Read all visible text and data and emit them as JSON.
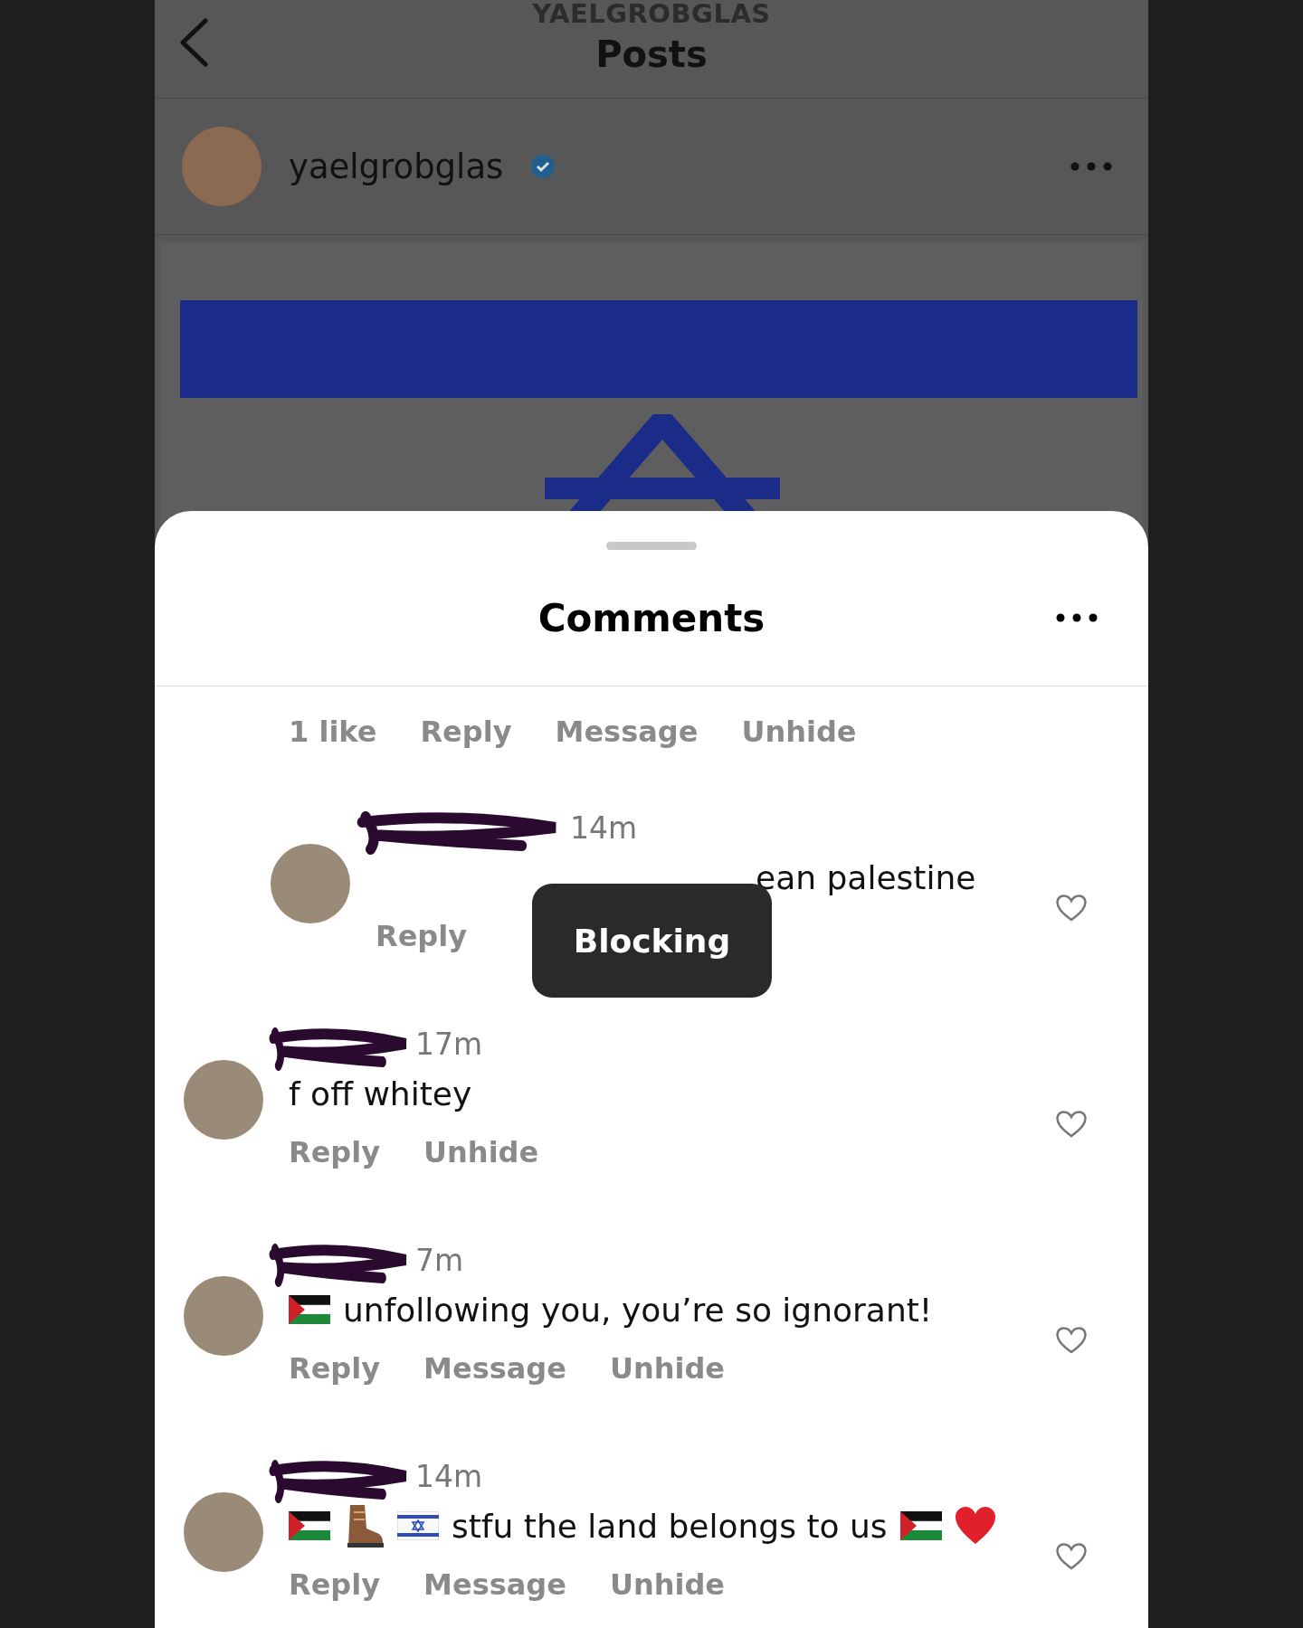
{
  "header": {
    "subtitle": "YAELGROBGLAS",
    "title": "Posts"
  },
  "post": {
    "username": "yaelgrobglas",
    "verified": true
  },
  "sheet": {
    "title": "Comments"
  },
  "comments": [
    {
      "kind": "partial",
      "actions": [
        "1 like",
        "Reply",
        "Message",
        "Unhide"
      ]
    },
    {
      "kind": "reply",
      "time": "14m",
      "parts": [
        {
          "kind": "text",
          "text": "ean palestine"
        }
      ],
      "actions": [
        "Reply"
      ]
    },
    {
      "kind": "comment",
      "time": "17m",
      "parts": [
        {
          "kind": "text",
          "text": "f off whitey"
        }
      ],
      "actions": [
        "Reply",
        "Unhide"
      ]
    },
    {
      "kind": "comment",
      "time": "7m",
      "parts": [
        {
          "kind": "flag-ps"
        },
        {
          "kind": "text",
          "text": "unfollowing you, you’re so ignorant!"
        }
      ],
      "actions": [
        "Reply",
        "Message",
        "Unhide"
      ]
    },
    {
      "kind": "comment",
      "time": "14m",
      "parts": [
        {
          "kind": "flag-ps"
        },
        {
          "kind": "boot"
        },
        {
          "kind": "flag-il"
        },
        {
          "kind": "text",
          "text": "stfu the land belongs to us"
        },
        {
          "kind": "flag-ps"
        },
        {
          "kind": "heart"
        }
      ],
      "actions": [
        "Reply",
        "Message",
        "Unhide"
      ]
    }
  ],
  "toast": {
    "text": "Blocking"
  }
}
